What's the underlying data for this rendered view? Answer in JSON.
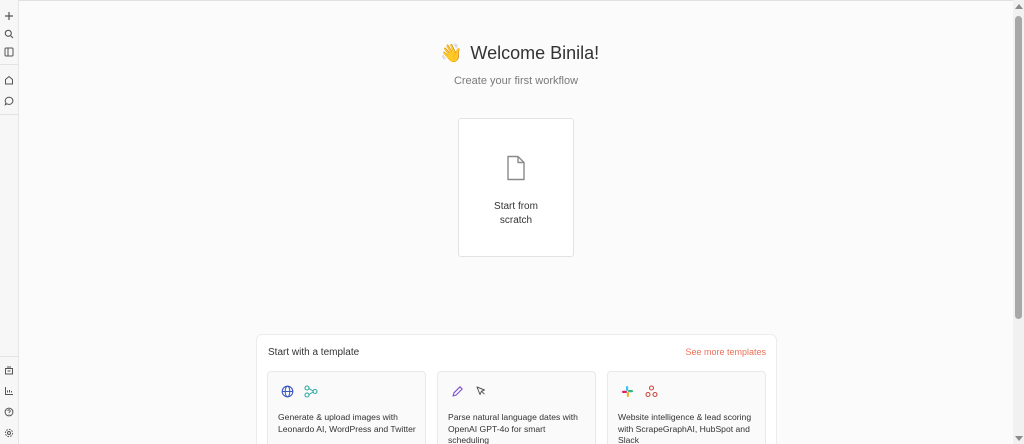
{
  "sidebar": {
    "top_icons": [
      "plus-icon",
      "search-icon",
      "panel-icon",
      "home-icon",
      "chat-icon"
    ],
    "bottom_icons": [
      "templates-icon",
      "analytics-icon",
      "help-icon",
      "settings-icon"
    ]
  },
  "welcome": {
    "emoji": "👋",
    "title": "Welcome Binila!",
    "subtitle": "Create your first workflow"
  },
  "scratch": {
    "label": "Start from scratch"
  },
  "templates": {
    "heading": "Start with a template",
    "see_more": "See more templates",
    "cards": [
      {
        "icons": [
          "globe-icon",
          "share-icon"
        ],
        "description": "Generate & upload images with Leonardo AI, WordPress and Twitter"
      },
      {
        "icons": [
          "pencil-icon",
          "cursor-icon"
        ],
        "description": "Parse natural language dates with OpenAI GPT-4o for smart scheduling"
      },
      {
        "icons": [
          "slack-icon",
          "network-icon"
        ],
        "description": "Website intelligence & lead scoring with ScrapeGraphAI, HubSpot and Slack"
      }
    ]
  },
  "colors": {
    "accent": "#e8715a",
    "background": "#fbfbfb"
  }
}
